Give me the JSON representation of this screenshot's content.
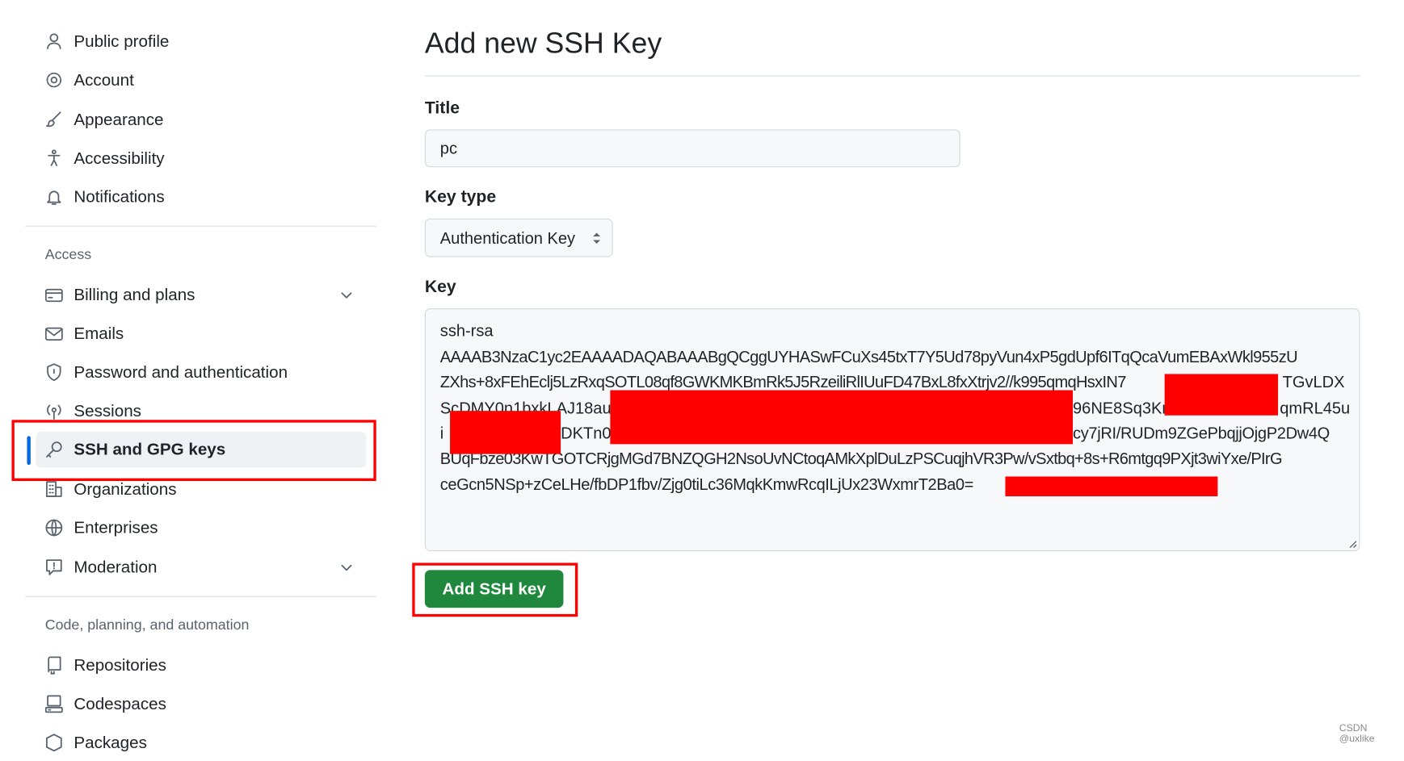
{
  "sidebar": {
    "items_top": [
      {
        "label": "Public profile",
        "icon": "person-icon"
      },
      {
        "label": "Account",
        "icon": "gear-icon"
      },
      {
        "label": "Appearance",
        "icon": "paintbrush-icon"
      },
      {
        "label": "Accessibility",
        "icon": "accessibility-icon"
      },
      {
        "label": "Notifications",
        "icon": "bell-icon"
      }
    ],
    "access_heading": "Access",
    "items_access": [
      {
        "label": "Billing and plans",
        "icon": "credit-card-icon"
      },
      {
        "label": "Emails",
        "icon": "mail-icon"
      },
      {
        "label": "Password and authentication",
        "icon": "shield-icon"
      },
      {
        "label": "Sessions",
        "icon": "broadcast-icon"
      },
      {
        "label": "SSH and GPG keys",
        "icon": "key-icon"
      },
      {
        "label": "Organizations",
        "icon": "organization-icon"
      },
      {
        "label": "Enterprises",
        "icon": "globe-icon"
      },
      {
        "label": "Moderation",
        "icon": "report-icon"
      }
    ],
    "code_heading": "Code, planning, and automation",
    "items_code": [
      {
        "label": "Repositories",
        "icon": "repo-icon"
      },
      {
        "label": "Codespaces",
        "icon": "codespaces-icon"
      },
      {
        "label": "Packages",
        "icon": "package-icon"
      }
    ]
  },
  "main": {
    "title": "Add new SSH Key",
    "title_label": "Title",
    "title_value": "pc",
    "key_type_label": "Key type",
    "key_type_value": "Authentication Key",
    "key_label": "Key",
    "key_lines": [
      "ssh-rsa",
      "AAAAB3NzaC1yc2EAAAADAQABAAABgQCggUYHASwFCuXs45txT7Y5Ud78pyVun4xP5gdUpf6ITqQcaVumEBAxWkl955zU",
      "ZXhs+8xFEhEclj5LzRxqSOTL08qf8GWKMKBmRk5J5RzeiliRlIUuFD47BxL8fxXtrjv2//k995qmqHsxIN7",
      "ScDMY0n1bxkLAJ18au",
      "i",
      "BUqFbze03KwTGOTCRjgMGd7BNZQGH2NsoUvNCtoqAMkXplDuLzPSCuqjhVR3Pw/vSxtbq+8s+R6mtgq9PXjt3wiYxe/PIrG",
      "ceGcn5NSp+zCeLHe/fbDP1fbv/Zjg0tiLc36MqkKmwRcqILjUx23WxmrT2Ba0="
    ],
    "key_fragments": {
      "l3b": "TGvLDX",
      "l4b": "96NE8Sq3Km",
      "l4c": "qmRL45u",
      "l5b": "DKTn0R",
      "l5c": "cy7jRI/RUDm9ZGePbqjjOjgP2Dw4Q"
    },
    "submit_label": "Add SSH key"
  },
  "watermark": "CSDN @uxlike",
  "colors": {
    "accent": "#0969da",
    "button": "#1f883d",
    "highlight": "#ff0000"
  }
}
